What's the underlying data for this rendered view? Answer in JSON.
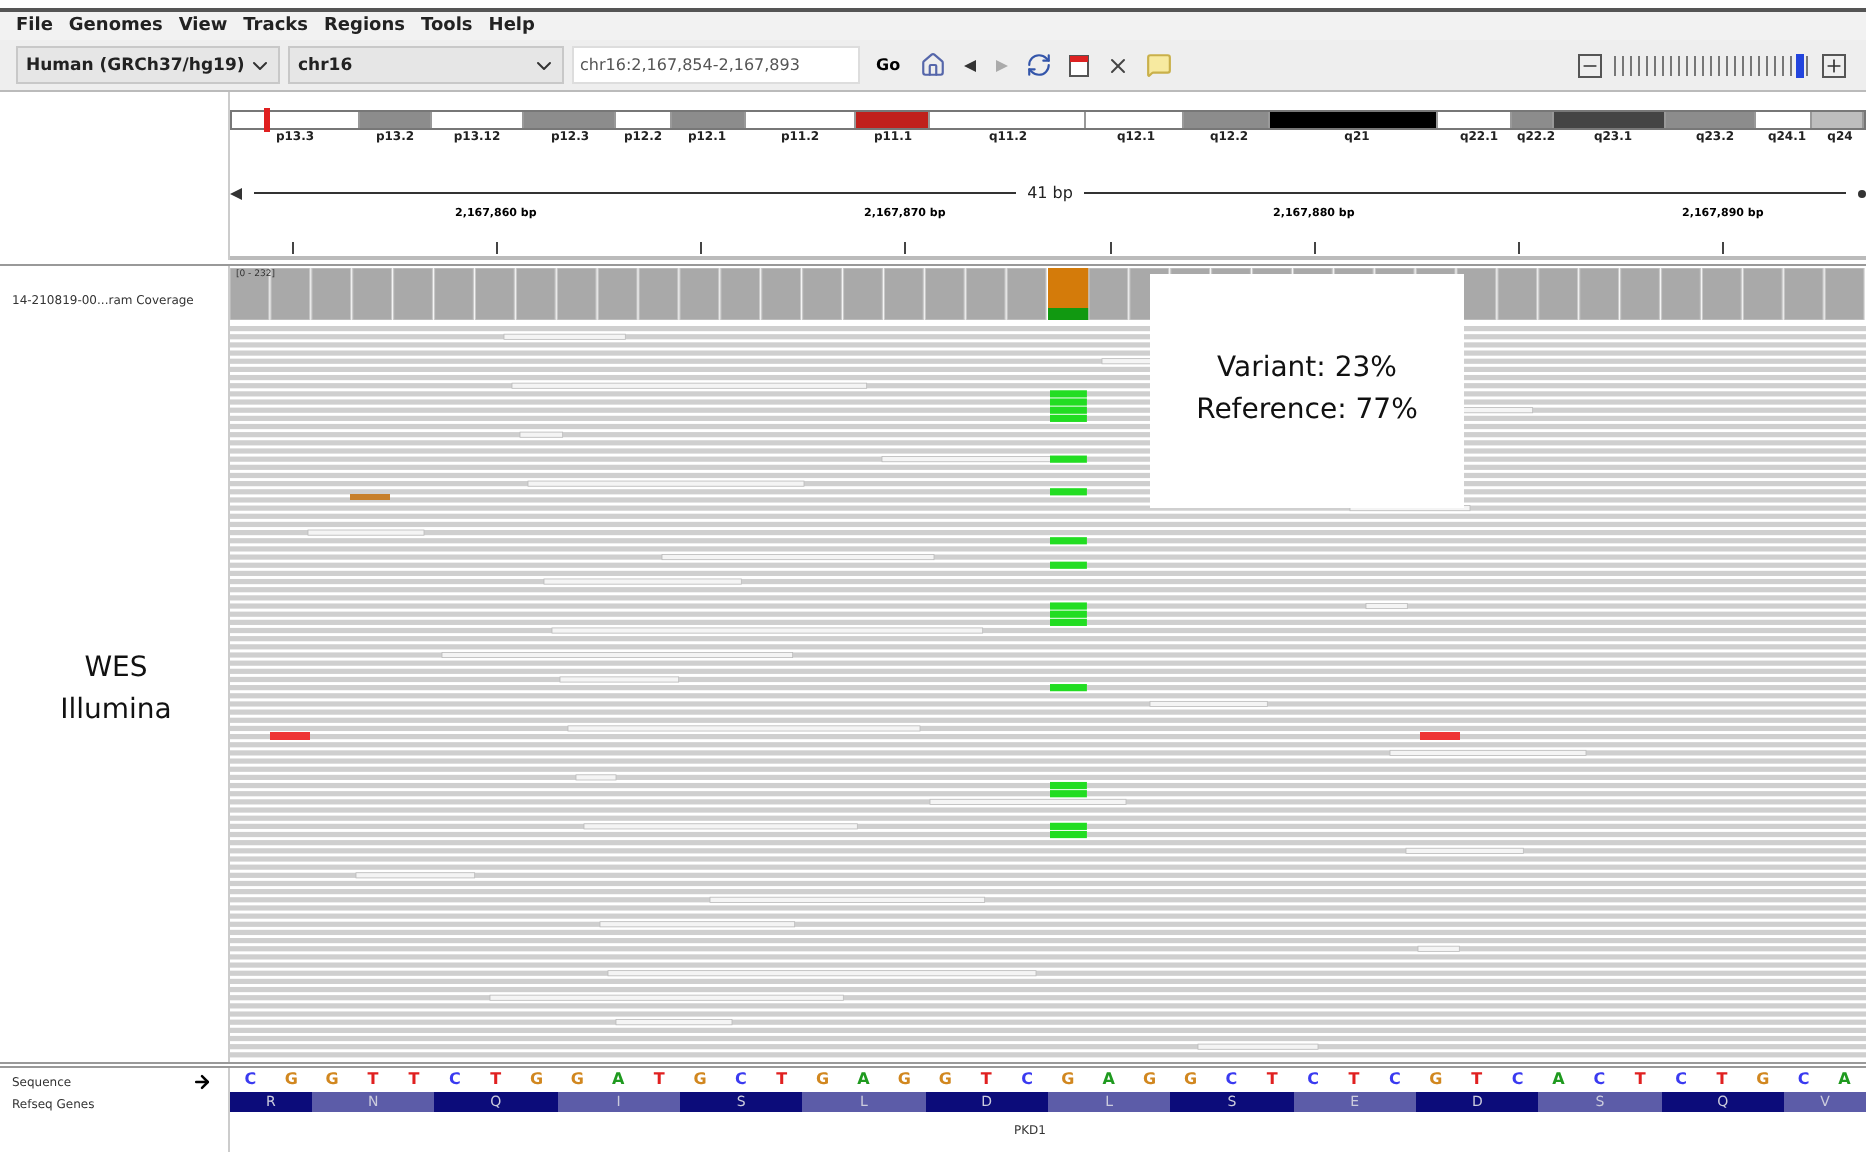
{
  "menu": [
    "File",
    "Genomes",
    "View",
    "Tracks",
    "Regions",
    "Tools",
    "Help"
  ],
  "toolbar": {
    "genome": "Human (GRCh37/hg19)",
    "chromosome": "chr16",
    "locus": "chr16:2,167,854-2,167,893",
    "go": "Go",
    "zoom": {
      "level": 0.97
    }
  },
  "ideogram": {
    "bands": [
      {
        "label": "p13.3",
        "color": "#ffffff"
      },
      {
        "label": "p13.2",
        "color": "#8c8c8c"
      },
      {
        "label": "p13.12",
        "color": "#ffffff"
      },
      {
        "label": "p12.3",
        "color": "#8c8c8c"
      },
      {
        "label": "p12.2",
        "color": "#ffffff"
      },
      {
        "label": "p12.1",
        "color": "#8c8c8c"
      },
      {
        "label": "p11.2",
        "color": "#ffffff"
      },
      {
        "label": "p11.1",
        "color": "#c0201c"
      },
      {
        "label": "q11.2",
        "color": "#ffffff"
      },
      {
        "label": "q12.1",
        "color": "#ffffff"
      },
      {
        "label": "q12.2",
        "color": "#8c8c8c"
      },
      {
        "label": "q21",
        "color": "#000000"
      },
      {
        "label": "q22.1",
        "color": "#ffffff"
      },
      {
        "label": "q22.2",
        "color": "#8c8c8c"
      },
      {
        "label": "q23.1",
        "color": "#444444"
      },
      {
        "label": "q23.2",
        "color": "#8c8c8c"
      },
      {
        "label": "q24.1",
        "color": "#ffffff"
      },
      {
        "label": "q24",
        "color": "#bdbdbd"
      }
    ]
  },
  "ruler": {
    "span": "41 bp",
    "ticks": [
      "2,167,860 bp",
      "2,167,870 bp",
      "2,167,880 bp",
      "2,167,890 bp"
    ]
  },
  "tracks": {
    "coverage": {
      "name": "14-210819-00...ram Coverage",
      "range": "[0 - 232]"
    }
  },
  "annotations": [
    {
      "lines": [
        "Variant: 23%",
        "Reference: 77%"
      ]
    },
    {
      "lines": [
        "WES",
        "Illumina"
      ]
    }
  ],
  "sequence": {
    "name": "Sequence",
    "bases": [
      {
        "base": "C",
        "color": "#3a3af0"
      },
      {
        "base": "G",
        "color": "#d1871f"
      },
      {
        "base": "G",
        "color": "#d1871f"
      },
      {
        "base": "T",
        "color": "#e02020"
      },
      {
        "base": "T",
        "color": "#e02020"
      },
      {
        "base": "C",
        "color": "#3a3af0"
      },
      {
        "base": "T",
        "color": "#e02020"
      },
      {
        "base": "G",
        "color": "#d1871f"
      },
      {
        "base": "G",
        "color": "#d1871f"
      },
      {
        "base": "A",
        "color": "#1f9a1f"
      },
      {
        "base": "T",
        "color": "#e02020"
      },
      {
        "base": "G",
        "color": "#d1871f"
      },
      {
        "base": "C",
        "color": "#3a3af0"
      },
      {
        "base": "T",
        "color": "#e02020"
      },
      {
        "base": "G",
        "color": "#d1871f"
      },
      {
        "base": "A",
        "color": "#1f9a1f"
      },
      {
        "base": "G",
        "color": "#d1871f"
      },
      {
        "base": "G",
        "color": "#d1871f"
      },
      {
        "base": "T",
        "color": "#e02020"
      },
      {
        "base": "C",
        "color": "#3a3af0"
      },
      {
        "base": "G",
        "color": "#d1871f"
      },
      {
        "base": "A",
        "color": "#1f9a1f"
      },
      {
        "base": "G",
        "color": "#d1871f"
      },
      {
        "base": "G",
        "color": "#d1871f"
      },
      {
        "base": "C",
        "color": "#3a3af0"
      },
      {
        "base": "T",
        "color": "#e02020"
      },
      {
        "base": "C",
        "color": "#3a3af0"
      },
      {
        "base": "T",
        "color": "#e02020"
      },
      {
        "base": "C",
        "color": "#3a3af0"
      },
      {
        "base": "G",
        "color": "#d1871f"
      },
      {
        "base": "T",
        "color": "#e02020"
      },
      {
        "base": "C",
        "color": "#3a3af0"
      },
      {
        "base": "A",
        "color": "#1f9a1f"
      },
      {
        "base": "C",
        "color": "#3a3af0"
      },
      {
        "base": "T",
        "color": "#e02020"
      },
      {
        "base": "C",
        "color": "#3a3af0"
      },
      {
        "base": "T",
        "color": "#e02020"
      },
      {
        "base": "G",
        "color": "#d1871f"
      },
      {
        "base": "C",
        "color": "#3a3af0"
      },
      {
        "base": "A",
        "color": "#1f9a1f"
      }
    ]
  },
  "genes": {
    "name": "Refseq Genes",
    "gene": "PKD1",
    "amino_acids": [
      {
        "aa": "R",
        "color": "#0c0c7a"
      },
      {
        "aa": "N",
        "color": "#5c5ca8"
      },
      {
        "aa": "Q",
        "color": "#0c0c7a"
      },
      {
        "aa": "I",
        "color": "#5c5ca8"
      },
      {
        "aa": "S",
        "color": "#0c0c7a"
      },
      {
        "aa": "L",
        "color": "#5c5ca8"
      },
      {
        "aa": "D",
        "color": "#0c0c7a"
      },
      {
        "aa": "L",
        "color": "#5c5ca8"
      },
      {
        "aa": "S",
        "color": "#0c0c7a"
      },
      {
        "aa": "E",
        "color": "#5c5ca8"
      },
      {
        "aa": "D",
        "color": "#0c0c7a"
      },
      {
        "aa": "S",
        "color": "#5c5ca8"
      },
      {
        "aa": "Q",
        "color": "#0c0c7a"
      },
      {
        "aa": "V",
        "color": "#5c5ca8"
      }
    ]
  }
}
